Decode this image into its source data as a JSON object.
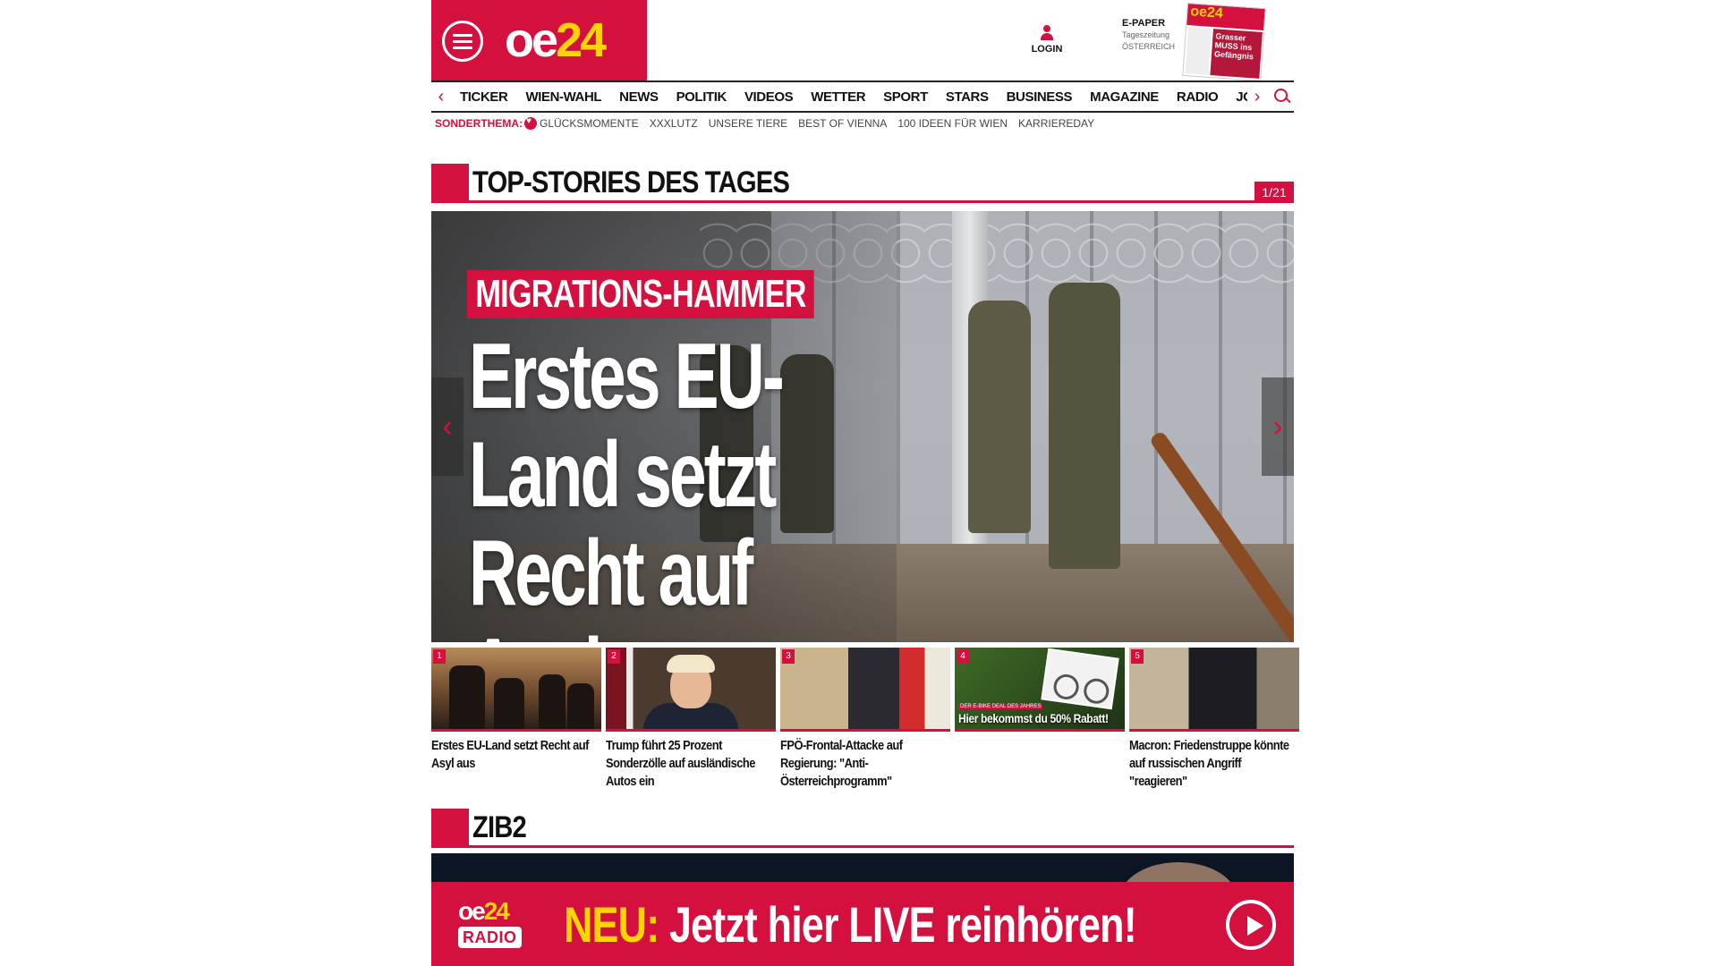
{
  "header": {
    "logo_oe": "oe",
    "logo_num": "24",
    "login_label": "LOGIN",
    "epaper": {
      "title": "E-PAPER",
      "subtitle": "Tageszeitung",
      "region": "ÖSTERREICH",
      "cover_logo": "oe24",
      "cover_headline": "Grasser MUSS ins Gefängnis"
    }
  },
  "nav": {
    "items": [
      "TICKER",
      "WIEN-WAHL",
      "NEWS",
      "POLITIK",
      "VIDEOS",
      "WETTER",
      "SPORT",
      "STARS",
      "BUSINESS",
      "MAGAZINE",
      "RADIO",
      "JOB"
    ]
  },
  "subnav": {
    "label": "SONDERTHEMA:",
    "links": [
      "GLÜCKSMOMENTE",
      "XXXLUTZ",
      "UNSERE TIERE",
      "BEST OF VIENNA",
      "100 IDEEN FÜR WIEN",
      "KARRIEREDAY"
    ]
  },
  "top_stories": {
    "title": "TOP-STORIES DES TAGES",
    "counter": "1/21",
    "hero": {
      "kicker": "MIGRATIONS-HAMMER",
      "headline": "Erstes EU-Land setzt Recht auf Asyl aus"
    },
    "thumbs": [
      {
        "num": "1",
        "caption": "Erstes EU-Land setzt Recht auf Asyl aus"
      },
      {
        "num": "2",
        "caption": "Trump führt 25 Prozent Sonderzölle auf ausländische Autos ein"
      },
      {
        "num": "3",
        "caption": "FPÖ-Frontal-Attacke auf Regierung: \"Anti-Österreichprogramm\""
      },
      {
        "num": "4",
        "caption": "",
        "badge": "Hier bekommst du 50% Rabatt!",
        "badge_top": "DER E-BIKE DEAL DES JAHRES"
      },
      {
        "num": "5",
        "caption": "Macron: Friedenstruppe könnte auf russischen Angriff \"reagieren\""
      }
    ]
  },
  "zib2": {
    "title": "ZIB2"
  },
  "radio_banner": {
    "logo_oe": "oe",
    "logo_num": "24",
    "logo_radio": "RADIO",
    "neu": "NEU:",
    "text": " Jetzt hier LIVE reinhören!"
  },
  "colors": {
    "brand_red": "#d4103f",
    "brand_yellow": "#ffd400"
  }
}
